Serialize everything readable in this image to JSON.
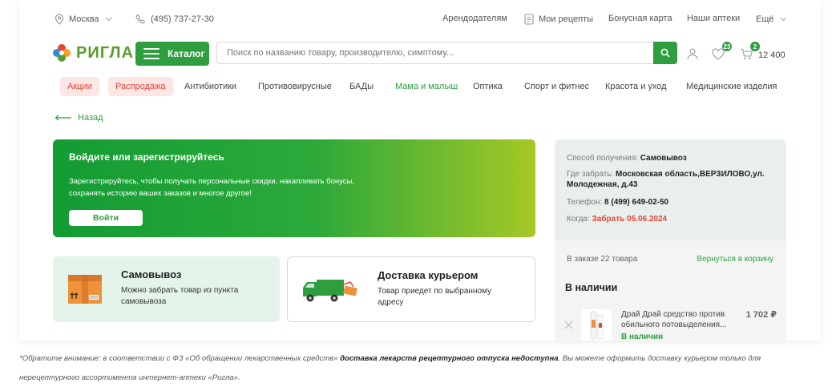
{
  "topbar": {
    "city": "Москва",
    "phone": "(495) 737-27-30",
    "links": [
      "Арендодателям",
      "Мои рецепты",
      "Бонусная карта",
      "Наши аптеки",
      "Ещё"
    ]
  },
  "header": {
    "logo": "РИГЛА",
    "catalog_label": "Каталог",
    "search_placeholder": "Поиск по названию товару, производителю, симптому...",
    "favorites_count": "23",
    "cart_count": "2",
    "cart_total": "12 400"
  },
  "nav": [
    "Акции",
    "Распродажа",
    "Антибиотики",
    "Противовирусные",
    "БАДы",
    "Мама и малыш",
    "Оптика",
    "Спорт и фитнес",
    "Красота и уход",
    "Медицинские изделия"
  ],
  "back_label": "Назад",
  "login_banner": {
    "title": "Войдите или зарегистрируйтесь",
    "text": "Зарегистрируйтесь, чтобы получать персональные скидки, накапливать бонусы, сохранять историю ваших заказов и многое другое!",
    "button": "Войти"
  },
  "delivery_options": [
    {
      "title": "Самовывоз",
      "text": "Можно забрать товар из пункта самовывоза"
    },
    {
      "title": "Доставка курьером",
      "text": "Товар приедет по выбранному адресу"
    }
  ],
  "pickup_info": {
    "method_label": "Способ получения: ",
    "method_value": "Самовывоз",
    "where_label": "Где забрать: ",
    "where_value": "Московская область,ВЕРЗИЛОВО,ул. Молодежная, д.43",
    "phone_label": "Телефон: ",
    "phone_value": "8 (499) 649-02-50",
    "when_label": "Когда: ",
    "when_value": "Забрать 05.06.2024"
  },
  "order": {
    "count": "В заказе 22 товара",
    "back_to_cart": "Вернуться в корзину",
    "section": "В наличии",
    "item": {
      "name": "Драй Драй средство против обильного потовыделения...",
      "stock": "В наличии",
      "price": "1 702 ₽"
    }
  },
  "footnote": {
    "prefix": "*Обратите внимание: в соответствии с ФЗ «Об обращении лекарственных средств» ",
    "bold": "доставка лекарств рецептурного отпуска недоступна",
    "suffix": ". Вы можете оформить доставку курьером только для нерецептурного ассортимента интернет-аптеки «Ригла»."
  },
  "colors": {
    "brand_green": "#2e9e3f",
    "sale_red": "#e2453b",
    "panel_bg": "#e9f0ec"
  }
}
